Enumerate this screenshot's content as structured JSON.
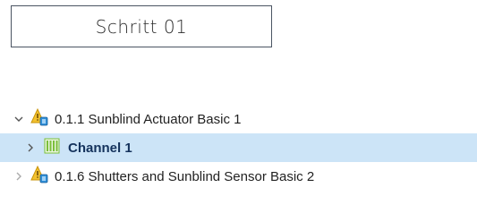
{
  "step": {
    "label": "Schritt 01"
  },
  "tree": {
    "items": [
      {
        "label": "0.1.1 Sunblind Actuator Basic 1",
        "expanded": true,
        "icon": "device-warning-icon"
      },
      {
        "label": "Channel 1",
        "expanded": false,
        "selected": true,
        "icon": "channel-icon"
      },
      {
        "label": "0.1.6 Shutters and Sunblind Sensor Basic 2",
        "expanded": false,
        "icon": "device-warning-icon"
      }
    ]
  },
  "colors": {
    "selection": "#cce4f7",
    "channel_green": "#7bbf3a",
    "warning_yellow": "#f2c12e",
    "device_blue": "#2f8fd8"
  }
}
